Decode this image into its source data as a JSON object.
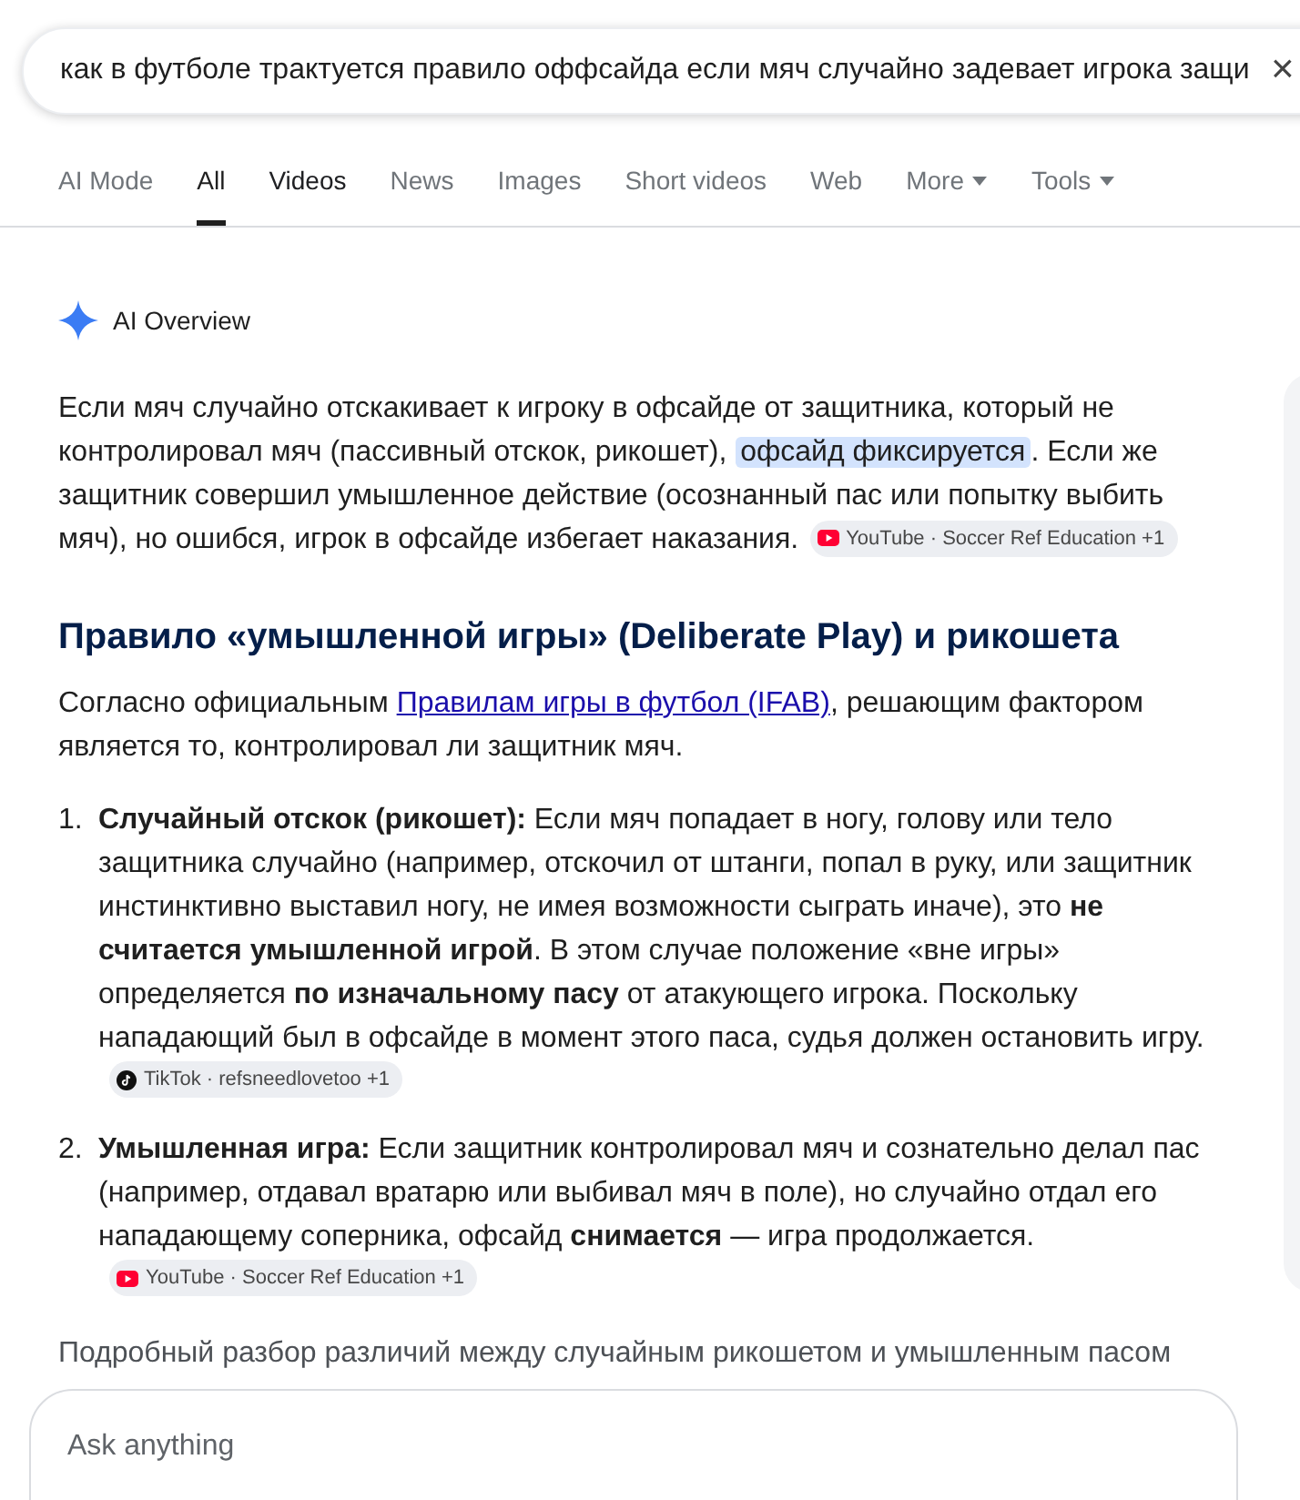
{
  "search": {
    "value": "как в футболе трактуется правило оффсайда если мяч случайно задевает игрока защи",
    "clear": "×"
  },
  "tabs": [
    {
      "label": "AI Mode",
      "selected": false,
      "highlighted": false
    },
    {
      "label": "All",
      "selected": true,
      "highlighted": false
    },
    {
      "label": "Videos",
      "selected": false,
      "highlighted": true
    },
    {
      "label": "News",
      "selected": false,
      "highlighted": false
    },
    {
      "label": "Images",
      "selected": false,
      "highlighted": false
    },
    {
      "label": "Short videos",
      "selected": false,
      "highlighted": false
    },
    {
      "label": "Web",
      "selected": false,
      "highlighted": false
    },
    {
      "label": "More",
      "selected": false,
      "highlighted": false,
      "dropdown": true
    },
    {
      "label": "Tools",
      "selected": false,
      "highlighted": false,
      "dropdown": true
    }
  ],
  "overview": {
    "title": "AI Overview",
    "intro": {
      "runs": [
        {
          "text": "Если мяч случайно отскакивает к игроку в офсайде от защитника, который не контролировал мяч (пассивный отскок, рикошет), ",
          "highlight": false
        },
        {
          "text": "офсайд фиксируется",
          "highlight": true
        },
        {
          "text": ". Если же защитник совершил умышленное действие (осознанный пас или попытку выбить мяч), но ошибся, игрок в офсайде избегает наказания.",
          "highlight": false
        }
      ],
      "source": {
        "kind": "youtube",
        "label": "YouTube · Soccer Ref Education +1"
      }
    },
    "heading": "Правило «умышленной игры» (Deliberate Play) и рикошета",
    "rules_text": {
      "before": "Согласно официальным ",
      "link": "Правилам игры в футбол (IFAB)",
      "after": ", решающим фактором является то, контролировал ли защитник мяч."
    },
    "items": [
      {
        "number": "1.",
        "text": "**Случайный отскок (рикошет):** Если мяч попадает в ногу, голову или тело защитника случайно (например, отскочил от штанги, попал в руку, или защитник инстинктивно выставил ногу, не имея возможности сыграть иначе), это **не считается умышленной игрой**. В этом случае положение «вне игры» определяется **по изначальному пасу** от атакующего игрока. Поскольку нападающий был в офсайде в момент этого паса, судья должен остановить игру.",
        "source": {
          "kind": "tiktok",
          "label": "TikTok · refsneedlovetoo +1"
        }
      },
      {
        "number": "2.",
        "text": "**Умышленная игра:** Если защитник контролировал мяч и сознательно делал пас (например, отдавал вратарю или выбивал мяч в поле), но случайно отдал его нападающему соперника, офсайд **снимается** — игра продолжается.",
        "source": {
          "kind": "youtube",
          "label": "YouTube · Soccer Ref Education +1"
        }
      }
    ],
    "more": "Подробный разбор различий между случайным рикошетом и умышленным пасом"
  },
  "ask": {
    "placeholder": "Ask anything"
  }
}
